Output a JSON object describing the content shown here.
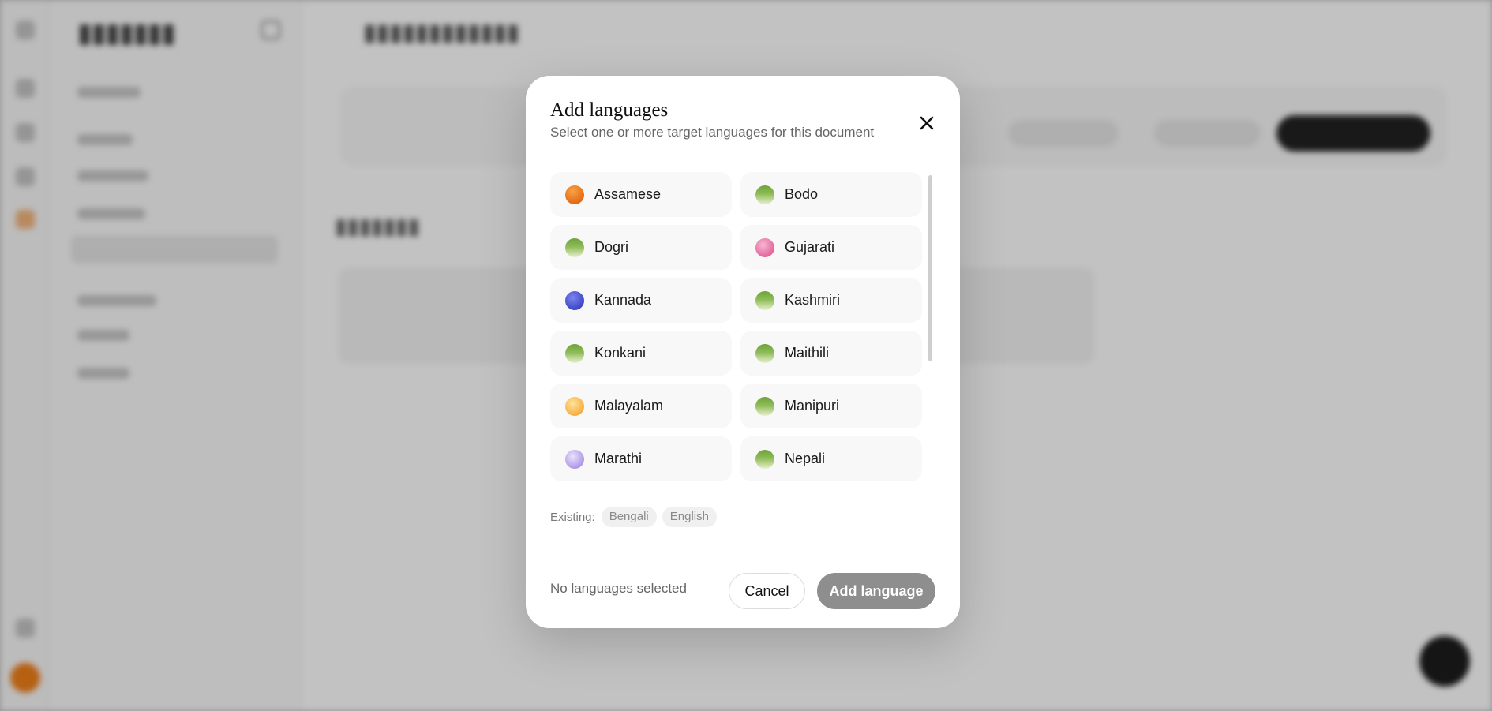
{
  "modal": {
    "title": "Add languages",
    "subtitle": "Select one or more target languages for this document",
    "close_icon": "close-icon",
    "languages": [
      {
        "name": "Assamese",
        "dot": "orange",
        "dot_color": "#e46b12"
      },
      {
        "name": "Bodo",
        "dot": "green",
        "dot_color": "#6da33a"
      },
      {
        "name": "Dogri",
        "dot": "green",
        "dot_color": "#6da33a"
      },
      {
        "name": "Gujarati",
        "dot": "pink",
        "dot_color": "#e2619b"
      },
      {
        "name": "Kannada",
        "dot": "blue",
        "dot_color": "#3a42c2"
      },
      {
        "name": "Kashmiri",
        "dot": "green",
        "dot_color": "#6da33a"
      },
      {
        "name": "Konkani",
        "dot": "green",
        "dot_color": "#6da33a"
      },
      {
        "name": "Maithili",
        "dot": "green",
        "dot_color": "#6da33a"
      },
      {
        "name": "Malayalam",
        "dot": "yellow",
        "dot_color": "#f6ab3c"
      },
      {
        "name": "Manipuri",
        "dot": "green",
        "dot_color": "#6da33a"
      },
      {
        "name": "Marathi",
        "dot": "lilac",
        "dot_color": "#a994e6"
      },
      {
        "name": "Nepali",
        "dot": "green",
        "dot_color": "#6da33a"
      }
    ],
    "existing_label": "Existing:",
    "existing": [
      "Bengali",
      "English"
    ],
    "footer": {
      "status": "No languages selected",
      "cancel_label": "Cancel",
      "add_label": "Add language"
    }
  },
  "colors": {
    "overlay": "rgba(0,0,0,0.24)",
    "primary_disabled": "#8e8e8e",
    "option_bg": "#f8f8f8"
  }
}
